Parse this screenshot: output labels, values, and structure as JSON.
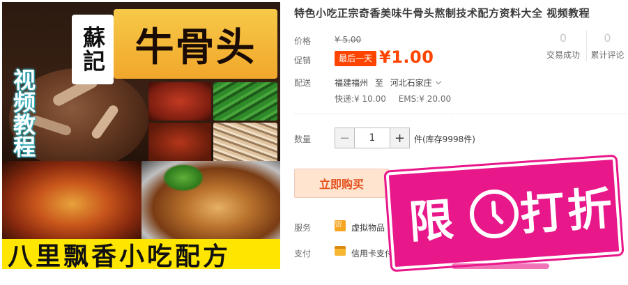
{
  "product_image": {
    "brand": "蘇記",
    "title": "牛骨头",
    "side_text": "视频教程",
    "bottom_banner": "八里飘香小吃配方"
  },
  "product": {
    "title": "特色小吃正宗奇香美味牛骨头熬制技术配方资料大全 视频教程",
    "price_label": "价格",
    "original_price": "¥ 5.00",
    "promo_label": "促销",
    "promo_badge": "最后一天",
    "promo_price": "¥1.00"
  },
  "stats": {
    "sales_count": "0",
    "sales_label": "交易成功",
    "reviews_count": "0",
    "reviews_label": "累计评论"
  },
  "shipping": {
    "label": "配送",
    "from": "福建福州",
    "to_word": "至",
    "to": "河北石家庄",
    "express": "快递:¥ 10.00",
    "ems": "EMS:¥ 20.00"
  },
  "quantity": {
    "label": "数量",
    "minus": "−",
    "value": "1",
    "plus": "+",
    "stock": "件(库存9998件)"
  },
  "actions": {
    "buy_now": "立即购买"
  },
  "service": {
    "label": "服务",
    "icon_text": "010 101",
    "value": "虚拟物品"
  },
  "payment": {
    "label": "支付",
    "value": "信用卡支付"
  },
  "overlay": {
    "stamp_left": "限",
    "stamp_right": "打折"
  },
  "colors": {
    "accent": "#ff4400",
    "buy_bg": "#ffe4d0",
    "stamp": "#e8178a",
    "banner_yellow": "#ffe600"
  }
}
